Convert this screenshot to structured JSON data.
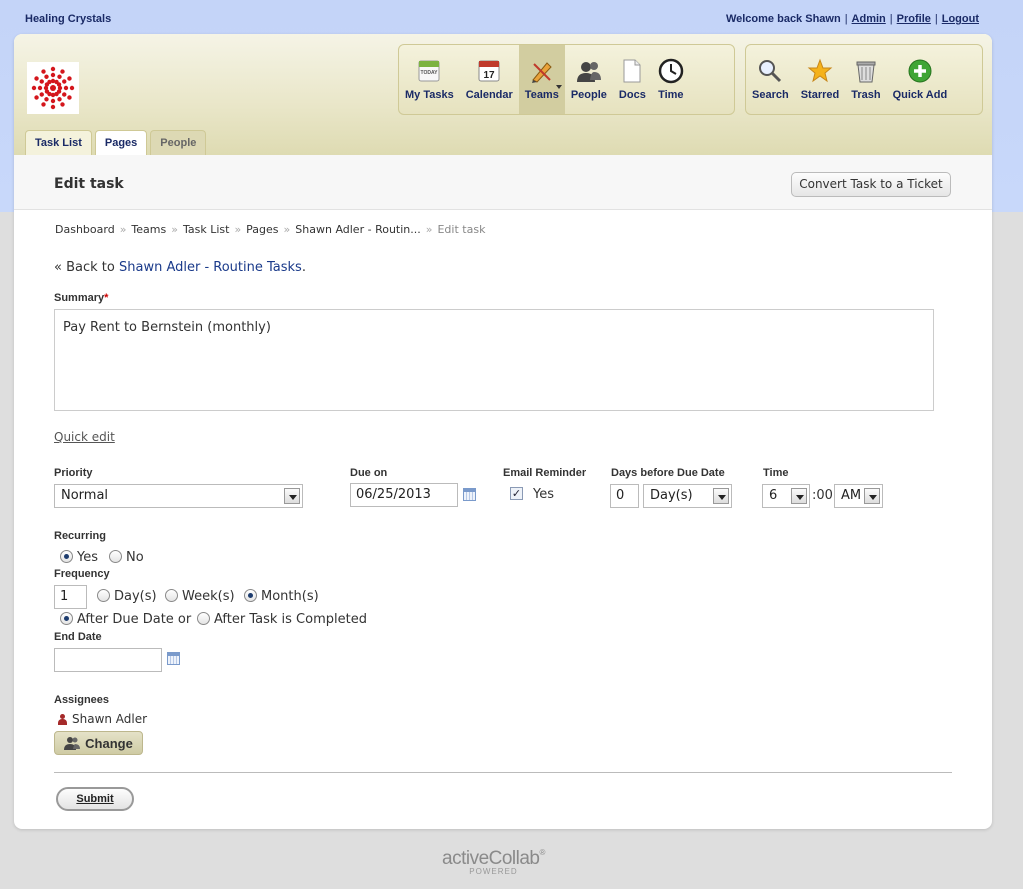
{
  "topbar": {
    "brand": "Healing Crystals",
    "welcome": "Welcome back Shawn",
    "links": [
      "Admin",
      "Profile",
      "Logout"
    ]
  },
  "toolbar": {
    "main": [
      {
        "label": "My Tasks",
        "icon": "my-tasks-icon"
      },
      {
        "label": "Calendar",
        "icon": "calendar-icon"
      },
      {
        "label": "Teams",
        "icon": "teams-icon",
        "active": true
      },
      {
        "label": "People",
        "icon": "people-icon"
      },
      {
        "label": "Docs",
        "icon": "docs-icon"
      },
      {
        "label": "Time",
        "icon": "clock-icon"
      }
    ],
    "side": [
      {
        "label": "Search",
        "icon": "search-icon"
      },
      {
        "label": "Starred",
        "icon": "star-icon"
      },
      {
        "label": "Trash",
        "icon": "trash-icon"
      },
      {
        "label": "Quick Add",
        "icon": "plus-icon"
      }
    ],
    "calendar_day": "17",
    "today_label": "TODAY"
  },
  "tabs": [
    {
      "label": "Task List",
      "state": "normal"
    },
    {
      "label": "Pages",
      "state": "active"
    },
    {
      "label": "People",
      "state": "inactive"
    }
  ],
  "page": {
    "title": "Edit task",
    "convert_button": "Convert Task to a Ticket"
  },
  "breadcrumb": [
    "Dashboard",
    "Teams",
    "Task List",
    "Pages",
    "Shawn Adler - Routin...",
    "Edit task"
  ],
  "back": {
    "prefix": "« Back to",
    "link": "Shawn Adler - Routine Tasks",
    "suffix": "."
  },
  "form": {
    "summary_label": "Summary",
    "summary_required": "*",
    "summary_value": "Pay Rent to Bernstein (monthly)",
    "quick_edit": "Quick edit",
    "priority_label": "Priority",
    "priority_value": "Normal",
    "due_label": "Due on",
    "due_value": "06/25/2013",
    "email_label": "Email Reminder",
    "email_checked": true,
    "email_option": "Yes",
    "days_label": "Days before Due Date",
    "days_value": "0",
    "days_unit": "Day(s)",
    "time_label": "Time",
    "time_hour": "6",
    "time_minutes": ":00",
    "time_ampm": "AM",
    "recurring_label": "Recurring",
    "recurring_yes": "Yes",
    "recurring_no": "No",
    "frequency_label": "Frequency",
    "frequency_value": "1",
    "freq_day": "Day(s)",
    "freq_week": "Week(s)",
    "freq_month": "Month(s)",
    "after_due": "After Due Date or",
    "after_completed": "After Task is Completed",
    "end_date_label": "End Date",
    "end_date_value": "",
    "assignees_label": "Assignees",
    "assignee_name": "Shawn Adler",
    "change_button": "Change",
    "submit_button": "Submit"
  },
  "footer": {
    "logo": "activeCollab",
    "registered": "®",
    "sub": "POWERED"
  },
  "colors": {
    "top_band": "#c4d4f8",
    "header_khaki": "#e9e6c8",
    "link_navy": "#1a2a66"
  }
}
